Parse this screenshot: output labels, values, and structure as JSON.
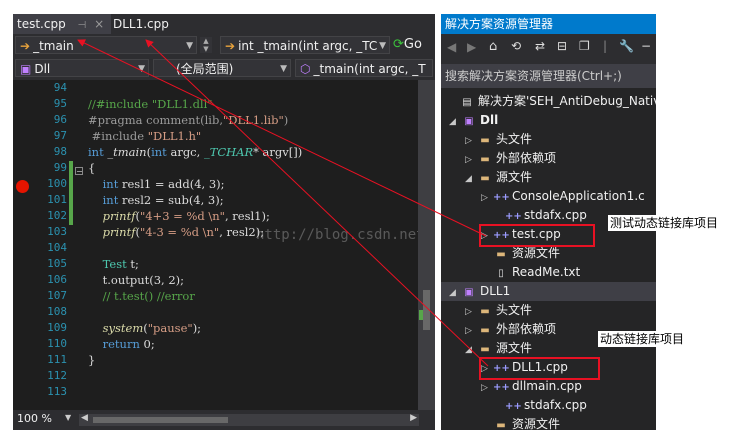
{
  "editor": {
    "tabs": [
      {
        "label": "test.cpp",
        "pin": "⊣",
        "close": "×"
      },
      {
        "label": "DLL1.cpp"
      }
    ],
    "nav": {
      "scope": "_tmain",
      "member": "int _tmain(int argc, _TC",
      "go_label": "Go"
    },
    "nav2": {
      "project": "Dll",
      "scope": "(全局范围)",
      "member": "_tmain(int argc, _T"
    },
    "line_numbers": [
      "94",
      "95",
      "96",
      "97",
      "98",
      "99",
      "100",
      "101",
      "102",
      "103",
      "104",
      "105",
      "106",
      "107",
      "108",
      "109",
      "110",
      "111",
      "112",
      "113"
    ],
    "watermark": "http://blog.csdn.net/",
    "zoom": "100 %"
  },
  "solution_explorer": {
    "title": "解决方案资源管理器",
    "search_placeholder": "搜索解决方案资源管理器(Ctrl+;)",
    "items": [
      {
        "label": "解决方案'SEH_AntiDebug_Native",
        "icon": "solution-icon"
      },
      {
        "label": "Dll",
        "icon": "project-icon"
      },
      {
        "label": "头文件",
        "icon": "folder-icon"
      },
      {
        "label": "外部依赖项",
        "icon": "folder-icon"
      },
      {
        "label": "源文件",
        "icon": "folder-icon"
      },
      {
        "label": "ConsoleApplication1.c",
        "icon": "cpp-file-icon"
      },
      {
        "label": "stdafx.cpp",
        "icon": "cpp-file-icon"
      },
      {
        "label": "test.cpp",
        "icon": "cpp-file-icon"
      },
      {
        "label": "资源文件",
        "icon": "folder-icon"
      },
      {
        "label": "ReadMe.txt",
        "icon": "text-file-icon"
      },
      {
        "label": "DLL1",
        "icon": "project-icon"
      },
      {
        "label": "头文件",
        "icon": "folder-icon"
      },
      {
        "label": "外部依赖项",
        "icon": "folder-icon"
      },
      {
        "label": "源文件",
        "icon": "folder-icon"
      },
      {
        "label": "DLL1.cpp",
        "icon": "cpp-file-icon"
      },
      {
        "label": "dllmain.cpp",
        "icon": "cpp-file-icon"
      },
      {
        "label": "stdafx.cpp",
        "icon": "cpp-file-icon"
      },
      {
        "label": "资源文件",
        "icon": "folder-icon"
      }
    ]
  },
  "annotations": {
    "test_project": "测试动态链接库项目",
    "dll_project": "动态链接库项目"
  },
  "colors": {
    "accent": "#007acc",
    "annotation_red": "#e81123"
  }
}
